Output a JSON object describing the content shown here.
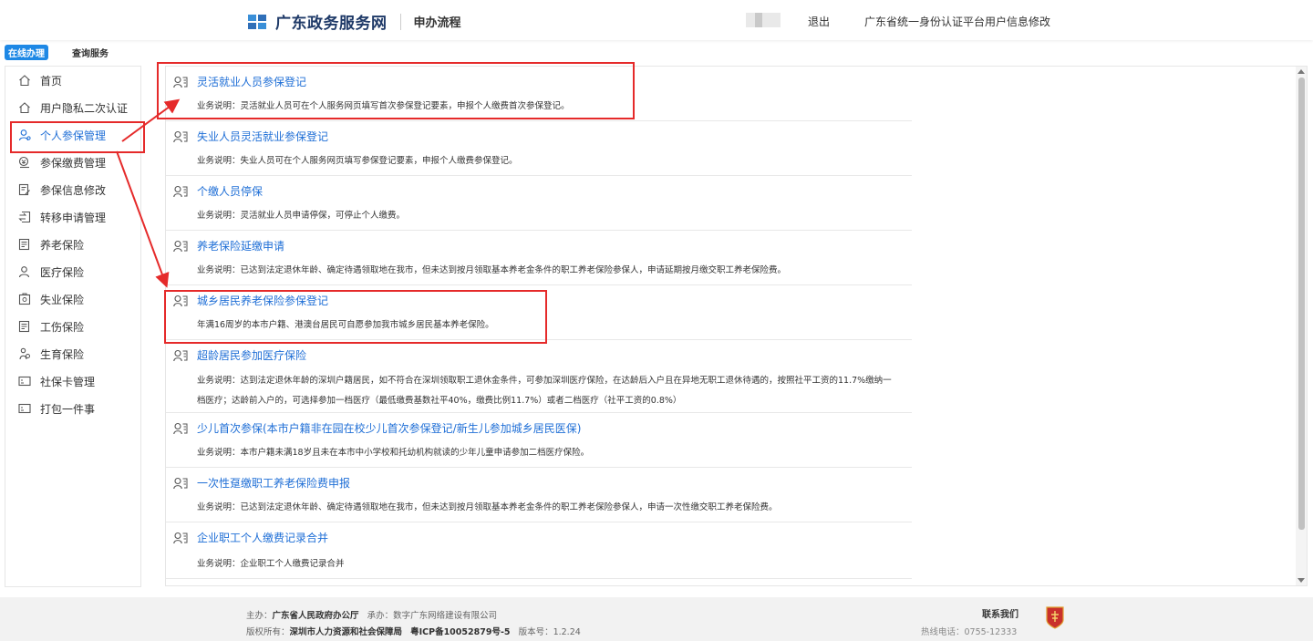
{
  "header": {
    "site_name": "广东政务服务网",
    "sub_title": "申办流程",
    "logout": "退出",
    "auth_link": "广东省统一身份认证平台用户信息修改"
  },
  "tabs": [
    {
      "label": "在线办理",
      "active": true
    },
    {
      "label": "查询服务",
      "active": false
    }
  ],
  "sidebar": {
    "items": [
      {
        "label": "首页",
        "icon": "home-icon"
      },
      {
        "label": "用户隐私二次认证",
        "icon": "home-icon"
      },
      {
        "label": "个人参保管理",
        "icon": "user-icon",
        "active": true
      },
      {
        "label": "参保缴费管理",
        "icon": "payment-icon"
      },
      {
        "label": "参保信息修改",
        "icon": "edit-icon"
      },
      {
        "label": "转移申请管理",
        "icon": "transfer-icon"
      },
      {
        "label": "养老保险",
        "icon": "document-icon"
      },
      {
        "label": "医疗保险",
        "icon": "medical-icon"
      },
      {
        "label": "失业保险",
        "icon": "unemployment-icon"
      },
      {
        "label": "工伤保险",
        "icon": "document-icon"
      },
      {
        "label": "生育保险",
        "icon": "maternity-icon"
      },
      {
        "label": "社保卡管理",
        "icon": "card-icon"
      },
      {
        "label": "打包一件事",
        "icon": "card-icon"
      }
    ]
  },
  "services": [
    {
      "title": "灵活就业人员参保登记",
      "desc": "业务说明：灵活就业人员可在个人服务网页填写首次参保登记要素，申报个人缴费首次参保登记。"
    },
    {
      "title": "失业人员灵活就业参保登记",
      "desc": "业务说明：失业人员可在个人服务网页填写参保登记要素，申报个人缴费参保登记。"
    },
    {
      "title": "个缴人员停保",
      "desc": "业务说明：灵活就业人员申请停保，可停止个人缴费。"
    },
    {
      "title": "养老保险延缴申请",
      "desc": "业务说明：已达到法定退休年龄、确定待遇领取地在我市，但未达到按月领取基本养老金条件的职工养老保险参保人，申请延期按月缴交职工养老保险费。"
    },
    {
      "title": "城乡居民养老保险参保登记",
      "desc": "年满16周岁的本市户籍、港澳台居民可自愿参加我市城乡居民基本养老保险。"
    },
    {
      "title": "超龄居民参加医疗保险",
      "desc": "业务说明：达到法定退休年龄的深圳户籍居民，如不符合在深圳领取职工退休金条件，可参加深圳医疗保险，在达龄后入户且在异地无职工退休待遇的，按照社平工资的11.7%缴纳一档医疗；达龄前入户的，可选择参加一档医疗（最低缴费基数社平40%，缴费比例11.7%）或者二档医疗（社平工资的0.8%）"
    },
    {
      "title": "少儿首次参保(本市户籍非在园在校少儿首次参保登记/新生儿参加城乡居民医保)",
      "desc": "业务说明：本市户籍未满18岁且未在本市中小学校和托幼机构就读的少年儿童申请参加二档医疗保险。"
    },
    {
      "title": "一次性趸缴职工养老保险费申报",
      "desc": "业务说明：已达到法定退休年龄、确定待遇领取地在我市，但未达到按月领取基本养老金条件的职工养老保险参保人，申请一次性缴交职工养老保险费。"
    },
    {
      "title": "企业职工个人缴费记录合并",
      "desc": "业务说明：企业职工个人缴费记录合并"
    }
  ],
  "footer": {
    "sponsor_label": "主办：",
    "sponsor": "广东省人民政府办公厅",
    "operator_label": "承办：",
    "operator": "数字广东网络建设有限公司",
    "copyright_label": "版权所有：",
    "copyright": "深圳市人力资源和社会保障局",
    "icp": "粤ICP备10052879号-5",
    "version_label": "版本号：",
    "version": "1.2.24",
    "contact_title": "联系我们",
    "hotline": "热线电话：0755-12333"
  },
  "colors": {
    "accent": "#1e6ed6",
    "tab_active": "#1e88e5",
    "annotation": "#e52a2a",
    "logo": "#1f3a68"
  }
}
